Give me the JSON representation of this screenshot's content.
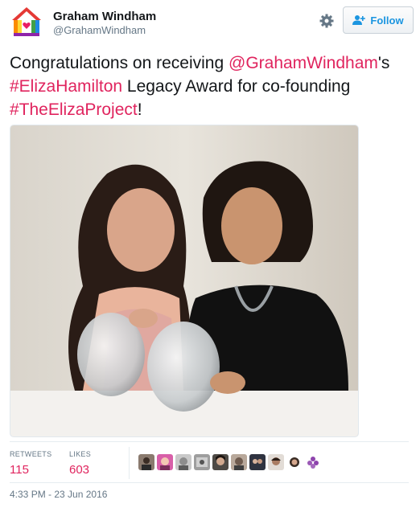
{
  "user": {
    "name": "Graham Windham",
    "handle": "@GrahamWindham"
  },
  "follow": {
    "label": "Follow"
  },
  "tweet": {
    "parts": [
      {
        "text": "Congratulations on receiving ",
        "link": false
      },
      {
        "text": "@GrahamWindham",
        "link": true
      },
      {
        "text": "'s ",
        "link": false
      },
      {
        "text": "#ElizaHamilton",
        "link": true
      },
      {
        "text": " Legacy Award for co-founding ",
        "link": false
      },
      {
        "text": "#TheElizaProject",
        "link": true
      },
      {
        "text": "!",
        "link": false
      }
    ]
  },
  "stats": {
    "retweets_label": "RETWEETS",
    "retweets_value": "115",
    "likes_label": "LIKES",
    "likes_value": "603"
  },
  "likers_count_shown": 10,
  "timestamp": "4:33 PM - 23 Jun 2016",
  "colors": {
    "accent": "#e0245e",
    "link_blue": "#1b95e0",
    "muted": "#657786"
  },
  "icons": {
    "gear": "gear-icon",
    "follow": "add-user-icon"
  }
}
